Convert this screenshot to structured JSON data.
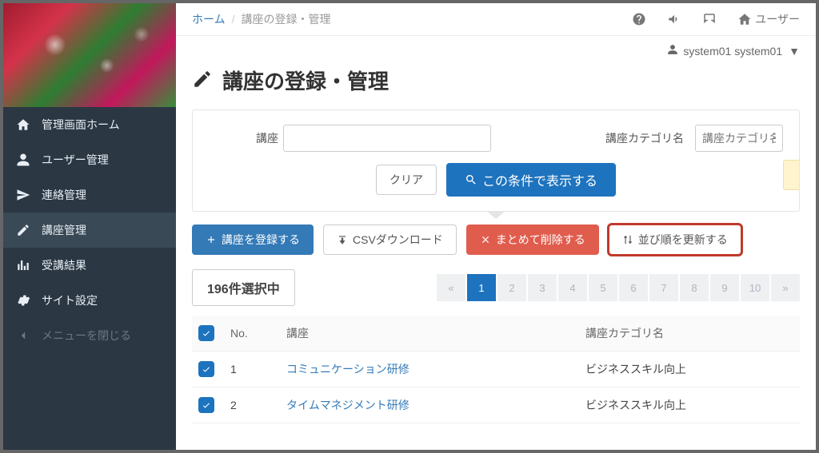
{
  "breadcrumb": {
    "home": "ホーム",
    "current": "講座の登録・管理"
  },
  "topbar": {
    "user_label": "ユーザー"
  },
  "user": {
    "display": "system01 system01"
  },
  "page": {
    "title": "講座の登録・管理"
  },
  "sidebar": {
    "items": [
      {
        "label": "管理画面ホーム"
      },
      {
        "label": "ユーザー管理"
      },
      {
        "label": "連絡管理"
      },
      {
        "label": "講座管理"
      },
      {
        "label": "受講結果"
      },
      {
        "label": "サイト設定"
      },
      {
        "label": "メニューを閉じる"
      }
    ]
  },
  "filter": {
    "course_label": "講座",
    "category_label": "講座カテゴリ名",
    "category_placeholder": "講座カテゴリ名",
    "clear": "クリア",
    "search": "この条件で表示する"
  },
  "actions": {
    "register": "講座を登録する",
    "csv": "CSVダウンロード",
    "bulk_delete": "まとめて削除する",
    "reorder": "並び順を更新する"
  },
  "selection": {
    "text": "196件選択中"
  },
  "pagination": {
    "pages": [
      "«",
      "1",
      "2",
      "3",
      "4",
      "5",
      "6",
      "7",
      "8",
      "9",
      "10",
      "»"
    ],
    "active_index": 1
  },
  "table": {
    "headers": {
      "no": "No.",
      "course": "講座",
      "category": "講座カテゴリ名"
    },
    "rows": [
      {
        "no": "1",
        "course": "コミュニケーション研修",
        "category": "ビジネススキル向上"
      },
      {
        "no": "2",
        "course": "タイムマネジメント研修",
        "category": "ビジネススキル向上"
      }
    ]
  },
  "colors": {
    "primary": "#1e73be",
    "danger": "#e05d4e",
    "highlight": "#c0392b"
  }
}
